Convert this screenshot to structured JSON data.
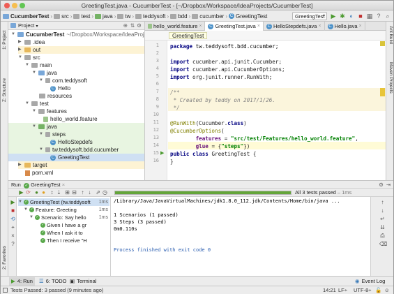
{
  "window": {
    "title": "GreetingTest.java - CucumberTest - [~/Dropbox/Workspace/IdeaProjects/CucumberTest]"
  },
  "navbar": {
    "crumbs": [
      "CucumberTest",
      "src",
      "test",
      "java",
      "tw",
      "teddysoft",
      "bdd",
      "cucumber",
      "GreetingTest"
    ],
    "run_config": "GreetingTest"
  },
  "side_tabs": {
    "project": "1: Project",
    "structure": "Z: Structure",
    "favorites": "2: Favorites",
    "ant_build": "Ant Build",
    "maven": "Maven Projects"
  },
  "project_panel": {
    "header": "Project",
    "tree": [
      {
        "label": "CucumberTest",
        "extra": "~/Dropbox/Workspace/IdeaProjects/CucumberTest",
        "depth": 0,
        "icon": "folder-blue"
      },
      {
        "label": ".idea",
        "depth": 1,
        "icon": "folder-gray"
      },
      {
        "label": "out",
        "depth": 1,
        "icon": "folder-yellow"
      },
      {
        "label": "src",
        "depth": 1,
        "icon": "folder-gray"
      },
      {
        "label": "main",
        "depth": 2,
        "icon": "folder-gray"
      },
      {
        "label": "java",
        "depth": 3,
        "icon": "folder-blue"
      },
      {
        "label": "com.teddysoft",
        "depth": 4,
        "icon": "package"
      },
      {
        "label": "Hello",
        "depth": 5,
        "icon": "class"
      },
      {
        "label": "resources",
        "depth": 3,
        "icon": "folder-gray"
      },
      {
        "label": "test",
        "depth": 2,
        "icon": "folder-gray"
      },
      {
        "label": "features",
        "depth": 3,
        "icon": "folder-gray"
      },
      {
        "label": "hello_world.feature",
        "depth": 4,
        "icon": "feature"
      },
      {
        "label": "java",
        "depth": 3,
        "icon": "folder-green"
      },
      {
        "label": "steps",
        "depth": 4,
        "icon": "package"
      },
      {
        "label": "HelloStepdefs",
        "depth": 5,
        "icon": "class"
      },
      {
        "label": "tw.teddysoft.bdd.cucumber",
        "depth": 4,
        "icon": "package"
      },
      {
        "label": "GreetingTest",
        "depth": 5,
        "icon": "class"
      },
      {
        "label": "target",
        "depth": 1,
        "icon": "folder-yellow"
      },
      {
        "label": "pom.xml",
        "depth": 1,
        "icon": "file"
      }
    ]
  },
  "editor": {
    "tabs": [
      {
        "label": "hello_world.feature",
        "active": false
      },
      {
        "label": "GreetingTest.java",
        "active": true
      },
      {
        "label": "HelloStepdefs.java",
        "active": false
      },
      {
        "label": "Hello.java",
        "active": false
      }
    ],
    "breadcrumb": "GreetingTest",
    "line_numbers": [
      "1",
      "2",
      "3",
      "4",
      "5",
      "6",
      "7",
      "8",
      "9",
      "10",
      "11",
      "12",
      "13",
      "14",
      "15",
      "16"
    ],
    "lines": {
      "l1_kw": "package ",
      "l1_rest": "tw.teddysoft.bdd.cucumber;",
      "l3_kw": "import ",
      "l3_rest": "cucumber.api.junit.Cucumber;",
      "l4_kw": "import ",
      "l4_rest": "cucumber.api.CucumberOptions;",
      "l5_kw": "import ",
      "l5_rest": "org.junit.runner.RunWith;",
      "l7": "/**",
      "l8": " * Created by teddy on 2017/1/26.",
      "l9": " */",
      "l11_ann": "@RunWith",
      "l11_rest": "(Cucumber.",
      "l11_kw": "class",
      "l11_end": ")",
      "l12_ann": "@CucumberOptions",
      "l12_rest": "(",
      "l13_fld": "        features",
      "l13_eq": " = ",
      "l13_str": "\"src/test/Features/hello_world.feature\"",
      "l13_end": ",",
      "l14_fld": "        glue",
      "l14_eq": " = {",
      "l14_str": "\"steps\"",
      "l14_end": "})",
      "l15_kw": "public class ",
      "l15_rest": "GreetingTest {",
      "l16": "}"
    }
  },
  "run_panel": {
    "title": "Run",
    "config": "GreetingTest",
    "status": "All 3 tests passed",
    "status_time": "– 1ms",
    "progress": 1.0,
    "tree": [
      {
        "label": "GreetingTest (tw.teddysoft",
        "time": "1ms",
        "depth": 0
      },
      {
        "label": "Feature: Greeting",
        "time": "1ms",
        "depth": 1
      },
      {
        "label": "Scenario: Say hello",
        "time": "1ms",
        "depth": 2
      },
      {
        "label": "Given I have a gr",
        "time": "",
        "depth": 3
      },
      {
        "label": "When I ask it to",
        "time": "",
        "depth": 3
      },
      {
        "label": "Then I receive \"H",
        "time": "",
        "depth": 3
      }
    ],
    "console": [
      "/Library/Java/JavaVirtualMachines/jdk1.8.0_112.jdk/Contents/Home/bin/java ...",
      "",
      "1 Scenarios (1 passed)",
      "3 Steps (3 passed)",
      "0m0.110s",
      "",
      "",
      "Process finished with exit code 0"
    ]
  },
  "bottom_tabs": {
    "run": "4: Run",
    "todo": "6: TODO",
    "terminal": "Terminal",
    "event_log": "Event Log"
  },
  "status_bar": {
    "message": "Tests Passed: 3 passed (9 minutes ago)",
    "position": "14:21",
    "line_sep": "LF÷",
    "encoding": "UTF-8÷"
  },
  "colors": {
    "keyword": "#000080",
    "string": "#008000",
    "annotation": "#808000",
    "comment": "#808080",
    "pass_green": "#59a84b"
  }
}
